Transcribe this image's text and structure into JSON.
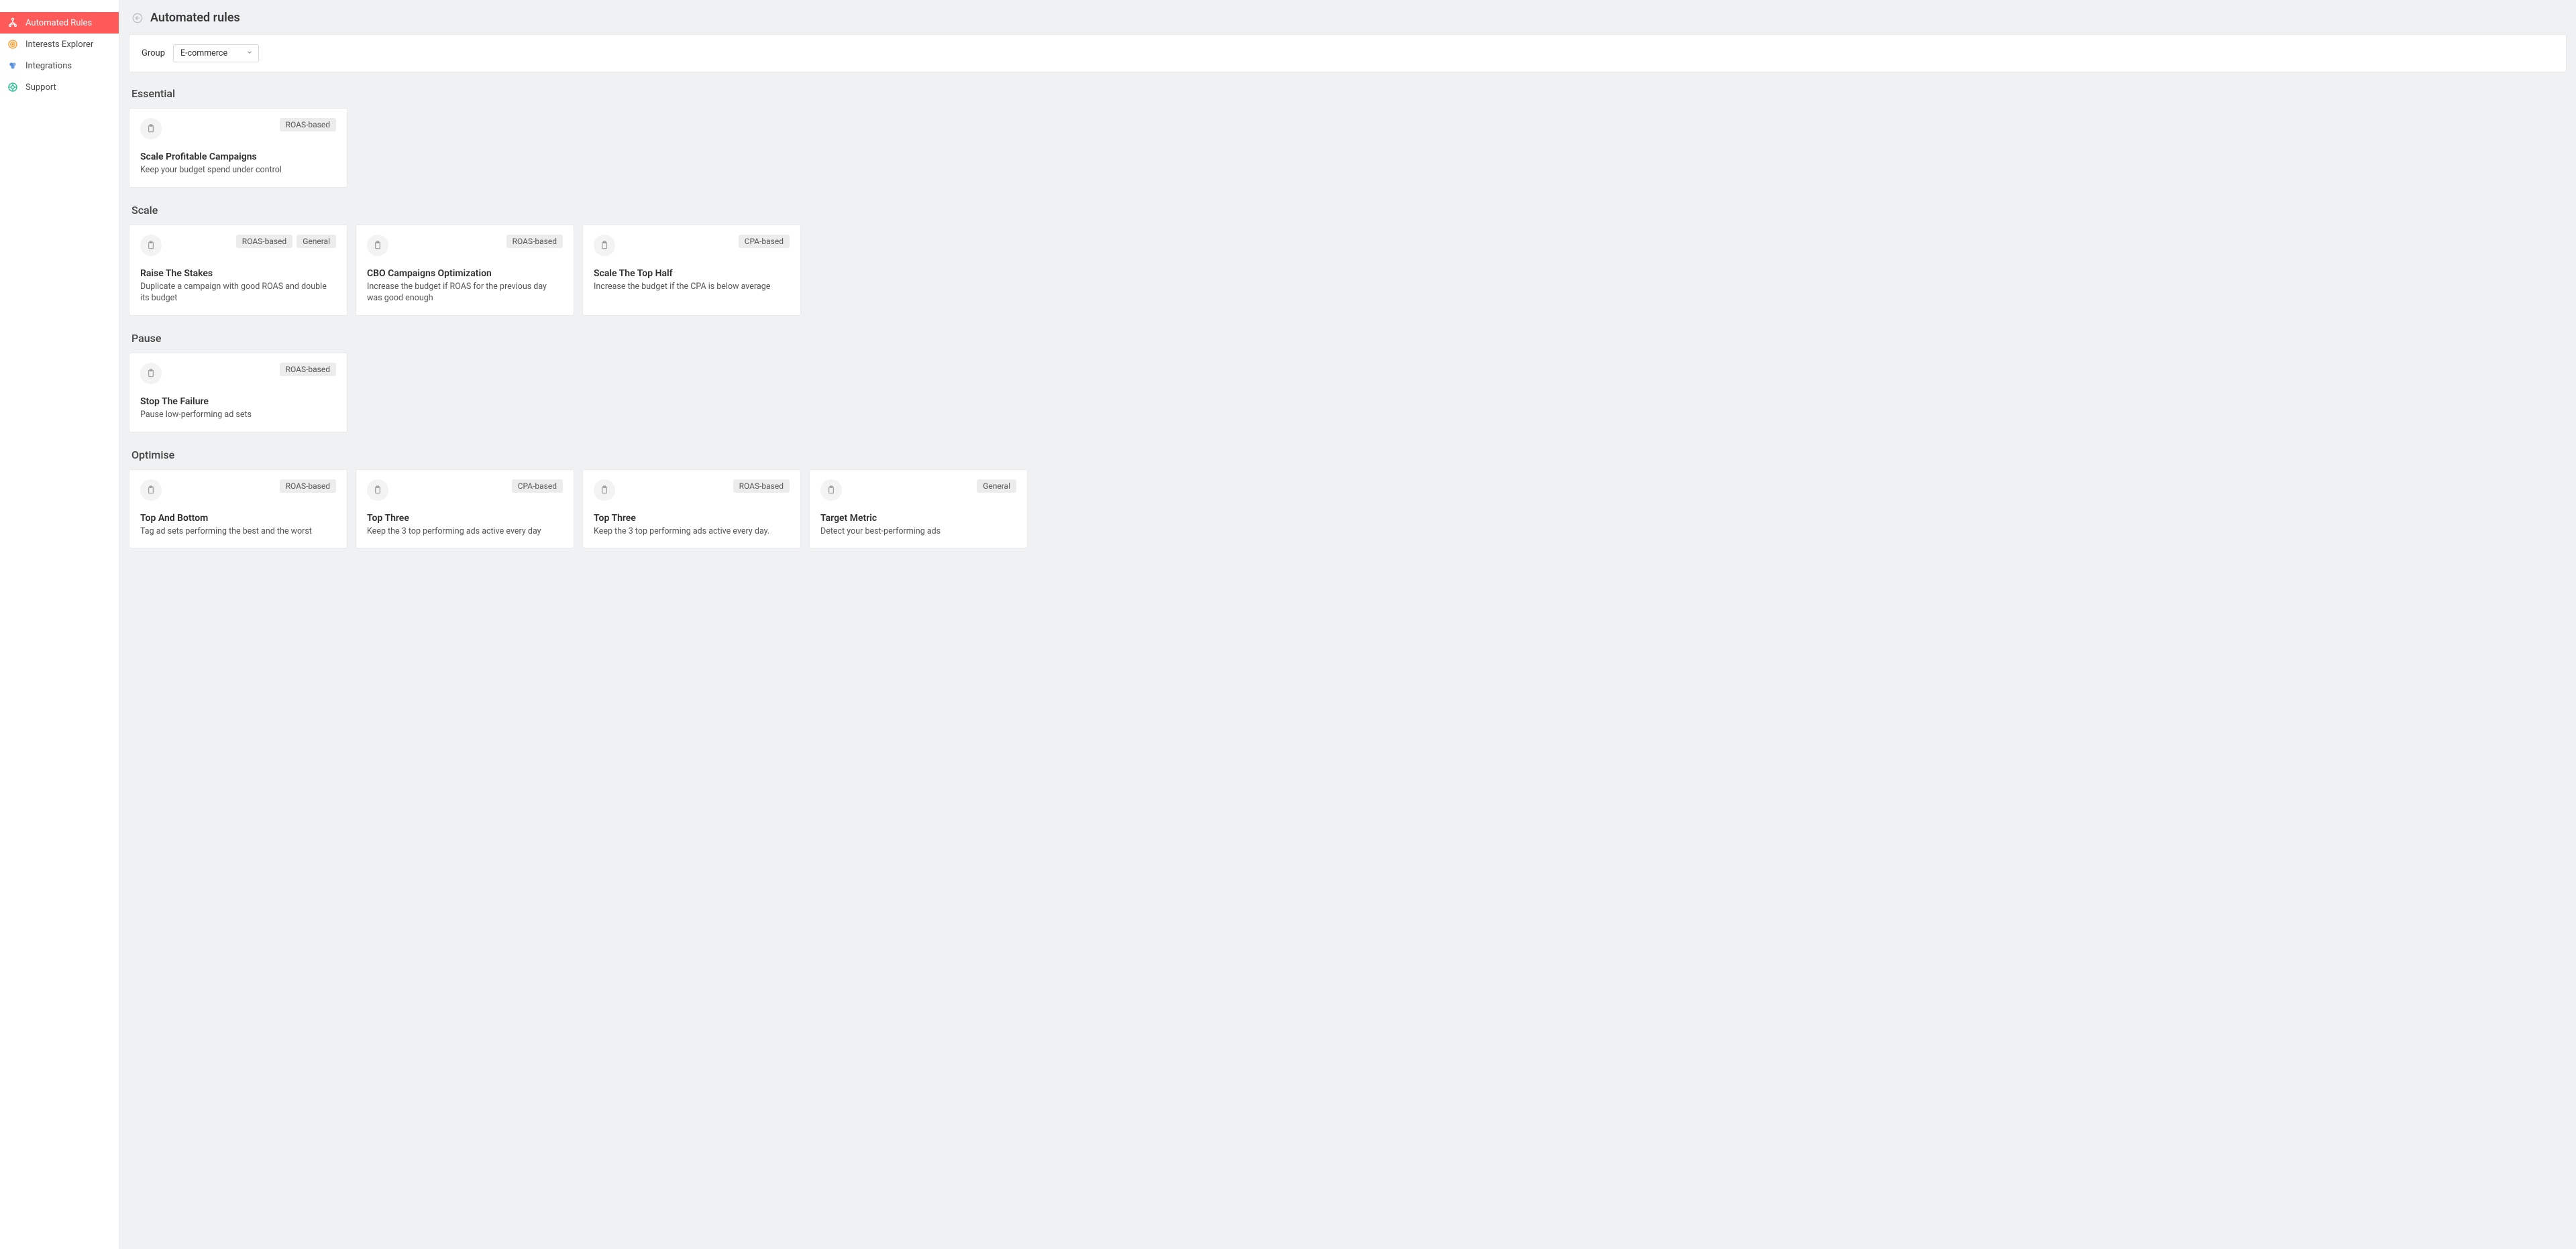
{
  "sidebar": {
    "items": [
      {
        "label": "Automated Rules"
      },
      {
        "label": "Interests Explorer"
      },
      {
        "label": "Integrations"
      },
      {
        "label": "Support"
      }
    ]
  },
  "header": {
    "title": "Automated rules"
  },
  "group": {
    "label": "Group",
    "selected": "E-commerce"
  },
  "sections": [
    {
      "title": "Essential",
      "cards": [
        {
          "tags": [
            "ROAS-based"
          ],
          "title": "Scale Profitable Campaigns",
          "desc": "Keep your budget spend under control"
        }
      ]
    },
    {
      "title": "Scale",
      "cards": [
        {
          "tags": [
            "ROAS-based",
            "General"
          ],
          "title": "Raise The Stakes",
          "desc": "Duplicate a campaign with good ROAS and double its budget"
        },
        {
          "tags": [
            "ROAS-based"
          ],
          "title": "CBO Campaigns Optimization",
          "desc": "Increase the budget if ROAS for the previous day was good enough"
        },
        {
          "tags": [
            "CPA-based"
          ],
          "title": "Scale The Top Half",
          "desc": "Increase the budget if the CPA is below average"
        }
      ]
    },
    {
      "title": "Pause",
      "cards": [
        {
          "tags": [
            "ROAS-based"
          ],
          "title": "Stop The Failure",
          "desc": "Pause low-performing ad sets"
        }
      ]
    },
    {
      "title": "Optimise",
      "cards": [
        {
          "tags": [
            "ROAS-based"
          ],
          "title": "Top And Bottom",
          "desc": "Tag ad sets performing the best and the worst"
        },
        {
          "tags": [
            "CPA-based"
          ],
          "title": "Top Three",
          "desc": "Keep the 3 top performing ads active every day"
        },
        {
          "tags": [
            "ROAS-based"
          ],
          "title": "Top Three",
          "desc": "Keep the 3 top performing ads active every day."
        },
        {
          "tags": [
            "General"
          ],
          "title": "Target Metric",
          "desc": "Detect your best-performing ads"
        }
      ]
    }
  ]
}
